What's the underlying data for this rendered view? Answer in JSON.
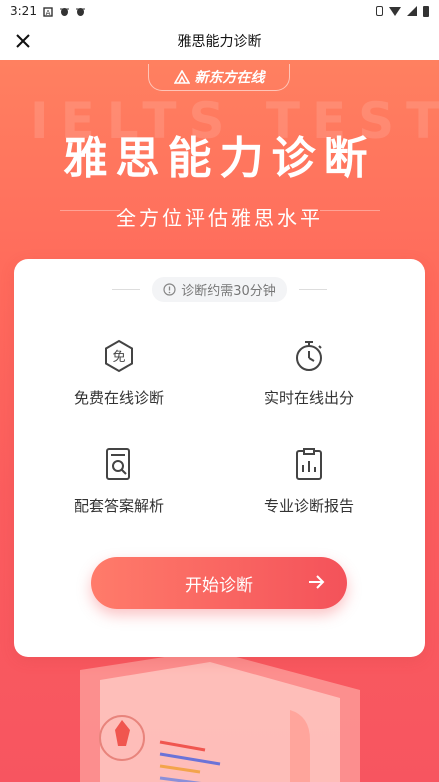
{
  "status_bar": {
    "time": "3:21"
  },
  "header": {
    "title": "雅思能力诊断"
  },
  "hero": {
    "brand": "新东方在线",
    "bg_text": "IELTS TEST",
    "title": "雅思能力诊断",
    "subtitle": "全方位评估雅思水平"
  },
  "card": {
    "tip": "诊断约需30分钟",
    "features": [
      {
        "icon": "free-badge-icon",
        "badge": "免",
        "label": "免费在线诊断"
      },
      {
        "icon": "stopwatch-icon",
        "label": "实时在线出分"
      },
      {
        "icon": "document-search-icon",
        "label": "配套答案解析"
      },
      {
        "icon": "report-clipboard-icon",
        "label": "专业诊断报告"
      }
    ],
    "start_label": "开始诊断"
  },
  "colors": {
    "accent": "#f4525a",
    "hero_top": "#ff8060",
    "hero_bottom": "#f75560"
  }
}
